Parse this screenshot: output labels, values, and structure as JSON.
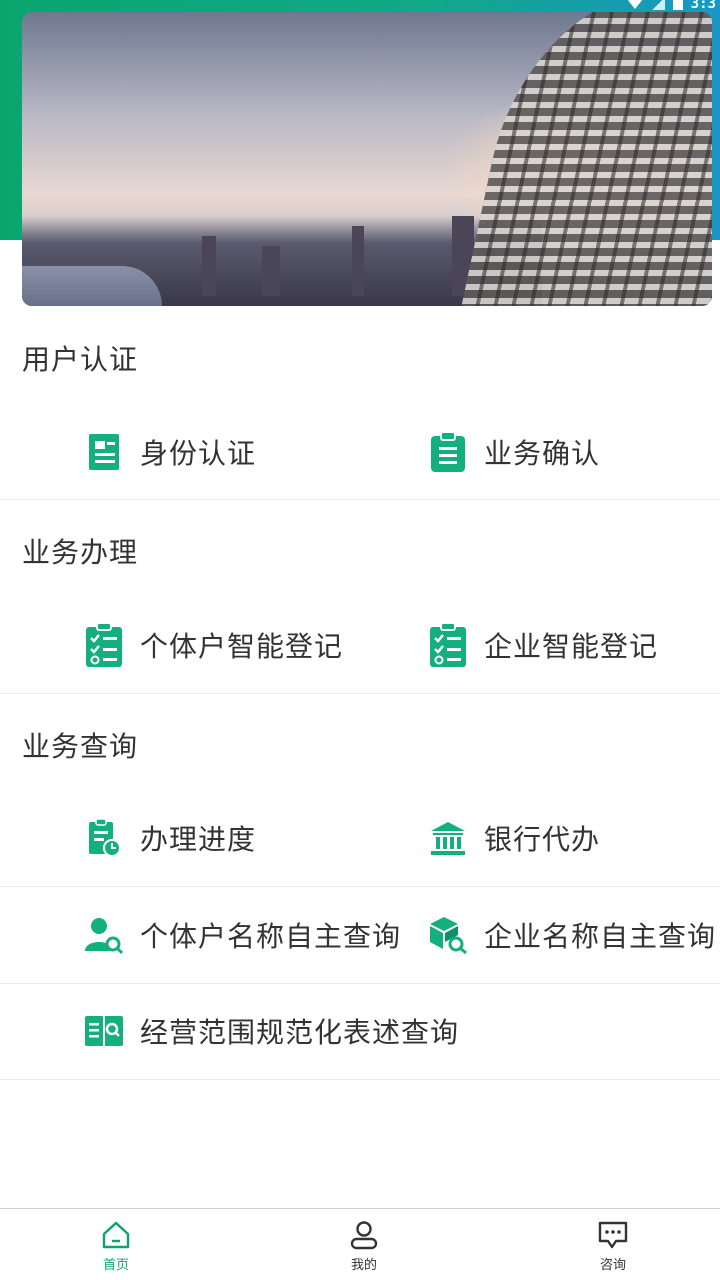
{
  "status_bar": {
    "time": "3:3"
  },
  "sections": {
    "user_auth": {
      "title": "用户认证",
      "items": [
        {
          "label": "身份认证",
          "icon": "id-card-icon"
        },
        {
          "label": "业务确认",
          "icon": "clipboard-icon"
        }
      ]
    },
    "business": {
      "title": "业务办理",
      "items": [
        {
          "label": "个体户智能登记",
          "icon": "checklist-icon"
        },
        {
          "label": "企业智能登记",
          "icon": "checklist-icon"
        }
      ]
    },
    "query": {
      "title": "业务查询",
      "items": [
        {
          "label": "办理进度",
          "icon": "progress-doc-icon"
        },
        {
          "label": "银行代办",
          "icon": "bank-icon"
        },
        {
          "label": "个体户名称自主查询",
          "icon": "person-search-icon"
        },
        {
          "label": "企业名称自主查询",
          "icon": "cube-search-icon"
        },
        {
          "label": "经营范围规范化表述查询",
          "icon": "book-search-icon"
        }
      ]
    }
  },
  "tabbar": {
    "tabs": [
      {
        "label": "首页",
        "icon": "home-icon",
        "active": true
      },
      {
        "label": "我的",
        "icon": "user-icon",
        "active": false
      },
      {
        "label": "咨询",
        "icon": "chat-icon",
        "active": false
      }
    ]
  },
  "colors": {
    "accent": "#0aa56f",
    "icon": "#13b07e",
    "text": "#333333",
    "divider": "#ececec"
  }
}
